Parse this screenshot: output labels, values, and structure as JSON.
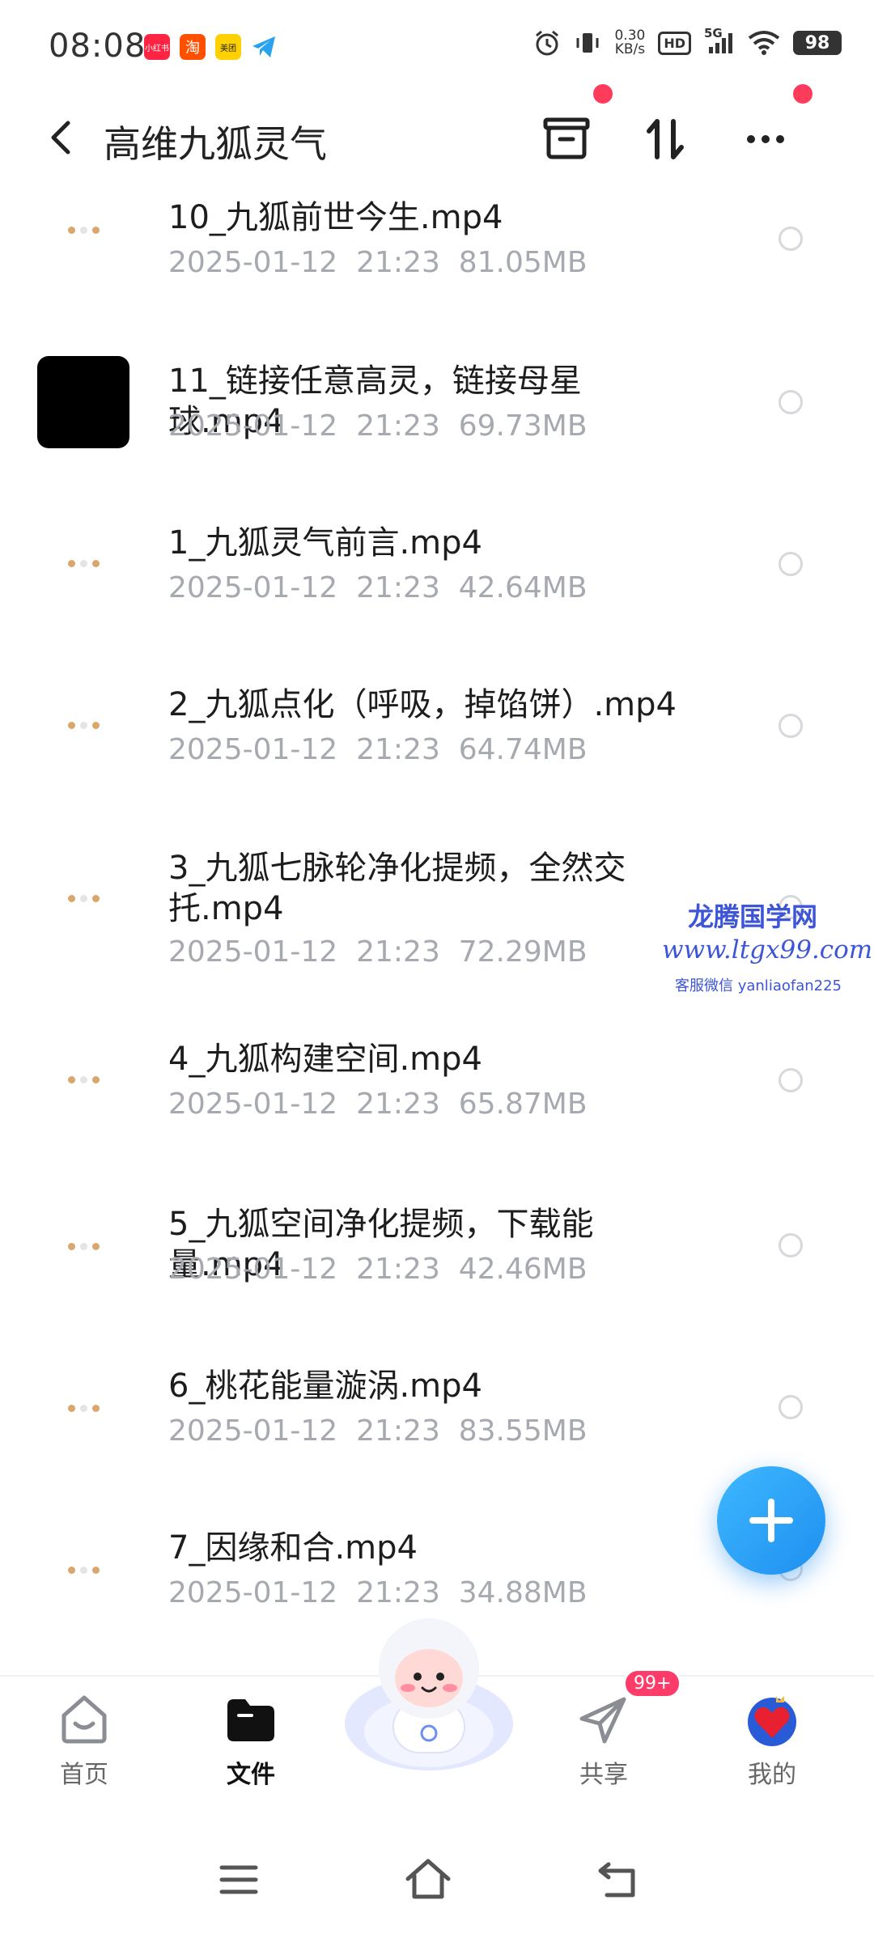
{
  "status_bar": {
    "time": "08:08",
    "notifications": [
      {
        "name": "xiaohongshu-icon",
        "label": "小红书",
        "color": "#ff2442"
      },
      {
        "name": "taobao-icon",
        "label": "淘",
        "color": "#ff5000"
      },
      {
        "name": "meituan-icon",
        "label": "美团",
        "color": "#ffd100"
      },
      {
        "name": "telegram-icon",
        "label": "",
        "color": "#2aa3ef"
      }
    ],
    "net_speed_value": "0.30",
    "net_speed_unit": "KB/s",
    "hd_label": "HD",
    "signal_label": "5G",
    "battery": "98"
  },
  "header": {
    "back_icon": "chevron-left-icon",
    "title": "高维九狐灵气",
    "actions": [
      "archive-icon",
      "sort-icon",
      "more-icon"
    ]
  },
  "files": [
    {
      "name": "10_九狐前世今生.mp4",
      "date": "2025-01-12",
      "time": "21:23",
      "size": "81.05MB",
      "thumb": "white"
    },
    {
      "name": "11_链接任意高灵，链接母星球.mp4",
      "date": "2025-01-12",
      "time": "21:23",
      "size": "69.73MB",
      "thumb": "black"
    },
    {
      "name": "1_九狐灵气前言.mp4",
      "date": "2025-01-12",
      "time": "21:23",
      "size": "42.64MB",
      "thumb": "white"
    },
    {
      "name": "2_九狐点化（呼吸，掉馅饼）.mp4",
      "date": "2025-01-12",
      "time": "21:23",
      "size": "64.74MB",
      "thumb": "white"
    },
    {
      "name": "3_九狐七脉轮净化提频，全然交托.mp4",
      "date": "2025-01-12",
      "time": "21:23",
      "size": "72.29MB",
      "thumb": "white"
    },
    {
      "name": "4_九狐构建空间.mp4",
      "date": "2025-01-12",
      "time": "21:23",
      "size": "65.87MB",
      "thumb": "white"
    },
    {
      "name": "5_九狐空间净化提频，下载能量.mp4",
      "date": "2025-01-12",
      "time": "21:23",
      "size": "42.46MB",
      "thumb": "white"
    },
    {
      "name": "6_桃花能量漩涡.mp4",
      "date": "2025-01-12",
      "time": "21:23",
      "size": "83.55MB",
      "thumb": "white"
    },
    {
      "name": "7_因缘和合.mp4",
      "date": "2025-01-12",
      "time": "21:23",
      "size": "34.88MB",
      "thumb": "white"
    }
  ],
  "watermark": {
    "line1": "龙腾国学网",
    "line2": "www.ltgx99.com",
    "line3": "客服微信 yanliaofan225"
  },
  "fab_icon": "plus-icon",
  "bottom_nav": {
    "items": [
      {
        "label": "首页",
        "icon": "home-icon",
        "active": false
      },
      {
        "label": "文件",
        "icon": "folder-icon",
        "active": true
      },
      {
        "label": "共享",
        "icon": "send-icon",
        "active": false,
        "badge": "99+"
      },
      {
        "label": "我的",
        "icon": "avatar-icon",
        "active": false
      }
    ],
    "center_icon": "mascot-icon"
  },
  "system_nav": [
    "menu-icon",
    "home-outline-icon",
    "back-icon"
  ],
  "colors": {
    "accent": "#1e8ff0",
    "red_dot": "#ff3b5c",
    "meta_text": "#a6a9b0",
    "watermark": "#3d55d6"
  }
}
